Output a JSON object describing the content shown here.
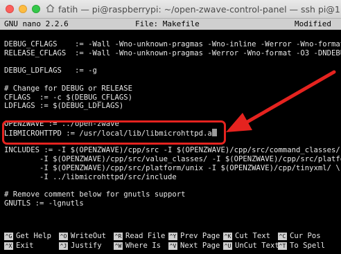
{
  "window": {
    "title": "fatih — pi@raspberrypi: ~/open-zwave-control-panel — ssh pi@1..."
  },
  "nano": {
    "app": "GNU nano 2.2.6",
    "file": "File: Makefile",
    "status": "Modified"
  },
  "editor": {
    "lines": [
      "",
      "DEBUG_CFLAGS    := -Wall -Wno-unknown-pragmas -Wno-inline -Werror -Wno-format -$",
      "RELEASE_CFLAGS  := -Wall -Wno-unknown-pragmas -Werror -Wno-format -O3 -DNDEBUG",
      "",
      "DEBUG_LDFLAGS   := -g",
      "",
      "# Change for DEBUG or RELEASE",
      "CFLAGS  := -c $(DEBUG_CFLAGS)",
      "LDFLAGS := $(DEBUG_LDFLAGS)",
      "",
      "OPENZWAVE := ../open-zwave",
      "LIBMICROHTTPD := /usr/local/lib/libmicrohttpd.a",
      "",
      "INCLUDES := -I $(OPENZWAVE)/cpp/src -I $(OPENZWAVE)/cpp/src/command_classes/ \\",
      "        -I $(OPENZWAVE)/cpp/src/value_classes/ -I $(OPENZWAVE)/cpp/src/platform$",
      "        -I $(OPENZWAVE)/cpp/src/platform/unix -I $(OPENZWAVE)/cpp/tinyxml/ \\",
      "        -I ../libmicrohttpd/src/include",
      "",
      "# Remove comment below for gnutls support",
      "GNUTLS := -lgnutls"
    ]
  },
  "shortcuts": [
    {
      "key": "^G",
      "label": "Get Help"
    },
    {
      "key": "^O",
      "label": "WriteOut"
    },
    {
      "key": "^R",
      "label": "Read File"
    },
    {
      "key": "^Y",
      "label": "Prev Page"
    },
    {
      "key": "^K",
      "label": "Cut Text"
    },
    {
      "key": "^C",
      "label": "Cur Pos"
    },
    {
      "key": "^X",
      "label": "Exit"
    },
    {
      "key": "^J",
      "label": "Justify"
    },
    {
      "key": "^W",
      "label": "Where Is"
    },
    {
      "key": "^V",
      "label": "Next Page"
    },
    {
      "key": "^U",
      "label": "UnCut Text"
    },
    {
      "key": "^T",
      "label": "To Spell"
    }
  ],
  "colors": {
    "annotation": "#e5231f",
    "terminal_bg": "#000000",
    "terminal_fg": "#e8e8e8",
    "nano_bar": "#cfcfcf"
  },
  "icons": [
    "home-icon",
    "arrow-icon"
  ]
}
